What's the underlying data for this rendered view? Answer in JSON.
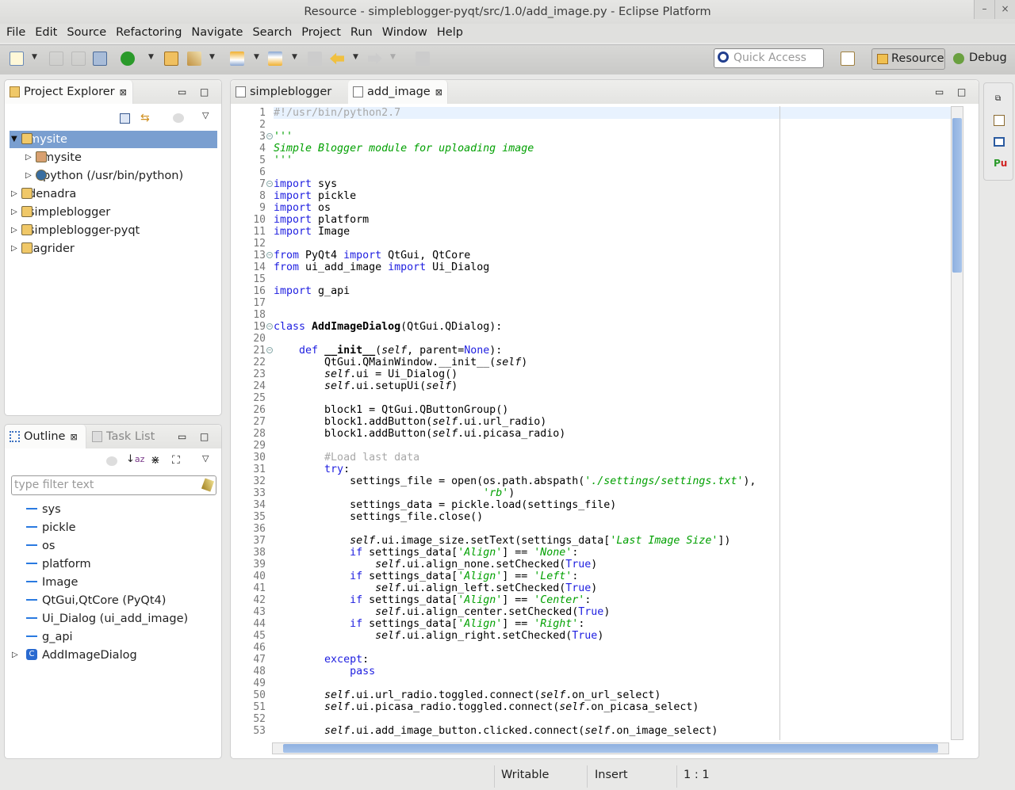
{
  "window": {
    "title": "Resource - simpleblogger-pyqt/src/1.0/add_image.py - Eclipse Platform",
    "controls": [
      "–",
      "×"
    ]
  },
  "menu": [
    "File",
    "Edit",
    "Source",
    "Refactoring",
    "Navigate",
    "Search",
    "Project",
    "Run",
    "Window",
    "Help"
  ],
  "toolbar": {
    "quick_access_placeholder": "Quick Access",
    "perspectives": [
      {
        "label": "Resource",
        "active": true
      },
      {
        "label": "Debug",
        "active": false
      }
    ]
  },
  "project_explorer": {
    "title": "Project Explorer",
    "close": "⊠",
    "items": [
      {
        "label": "mysite",
        "level": 0,
        "expanded": true,
        "selected": true,
        "icon": "pydev-project-icon"
      },
      {
        "label": "mysite",
        "level": 1,
        "icon": "package-icon"
      },
      {
        "label": "python (/usr/bin/python)",
        "level": 1,
        "icon": "python-interpreter-icon"
      },
      {
        "label": "denadra",
        "level": 0,
        "icon": "pydev-project-icon"
      },
      {
        "label": "simpleblogger",
        "level": 0,
        "icon": "pydev-project-icon"
      },
      {
        "label": "simpleblogger-pyqt",
        "level": 0,
        "icon": "pydev-project-icon"
      },
      {
        "label": "tagrider",
        "level": 0,
        "icon": "pydev-project-icon"
      }
    ]
  },
  "outline": {
    "title": "Outline",
    "close": "⊠",
    "other_tab": "Task List",
    "filter_placeholder": "type filter text",
    "items": [
      {
        "label": "sys",
        "type": "import"
      },
      {
        "label": "pickle",
        "type": "import"
      },
      {
        "label": "os",
        "type": "import"
      },
      {
        "label": "platform",
        "type": "import"
      },
      {
        "label": "Image",
        "type": "import"
      },
      {
        "label": "QtGui,QtCore (PyQt4)",
        "type": "import"
      },
      {
        "label": "Ui_Dialog (ui_add_image)",
        "type": "import"
      },
      {
        "label": "g_api",
        "type": "import"
      },
      {
        "label": "AddImageDialog",
        "type": "class"
      }
    ]
  },
  "editor": {
    "tabs": [
      {
        "label": "simpleblogger",
        "active": false
      },
      {
        "label": "add_image",
        "active": true,
        "close": "⊠"
      }
    ],
    "lines": [
      [
        [
          "c",
          "#!/usr/bin/python2.7"
        ]
      ],
      [],
      [
        [
          "s",
          "'''"
        ]
      ],
      [
        [
          "s",
          "Simple Blogger module for uploading image"
        ]
      ],
      [
        [
          "s",
          "'''"
        ]
      ],
      [],
      [
        [
          "k",
          "import"
        ],
        [
          "d",
          " sys"
        ]
      ],
      [
        [
          "k",
          "import"
        ],
        [
          "d",
          " pickle"
        ]
      ],
      [
        [
          "k",
          "import"
        ],
        [
          "d",
          " os"
        ]
      ],
      [
        [
          "k",
          "import"
        ],
        [
          "d",
          " platform"
        ]
      ],
      [
        [
          "k",
          "import"
        ],
        [
          "d",
          " Image"
        ]
      ],
      [],
      [
        [
          "k",
          "from"
        ],
        [
          "d",
          " PyQt4 "
        ],
        [
          "k",
          "import"
        ],
        [
          "d",
          " QtGui, QtCore"
        ]
      ],
      [
        [
          "k",
          "from"
        ],
        [
          "d",
          " ui_add_image "
        ],
        [
          "k",
          "import"
        ],
        [
          "d",
          " Ui_Dialog"
        ]
      ],
      [],
      [
        [
          "k",
          "import"
        ],
        [
          "d",
          " g_api"
        ]
      ],
      [],
      [],
      [
        [
          "k",
          "class"
        ],
        [
          "d",
          " "
        ],
        [
          "b",
          "AddImageDialog"
        ],
        [
          "d",
          "(QtGui.QDialog):"
        ]
      ],
      [],
      [
        [
          "d",
          "    "
        ],
        [
          "k",
          "def"
        ],
        [
          "d",
          " "
        ],
        [
          "b",
          "__init__"
        ],
        [
          "d",
          "("
        ],
        [
          "i",
          "self"
        ],
        [
          "d",
          ", parent="
        ],
        [
          "k",
          "None"
        ],
        [
          "d",
          "):"
        ]
      ],
      [
        [
          "d",
          "        QtGui.QMainWindow.__init__("
        ],
        [
          "i",
          "self"
        ],
        [
          "d",
          ")"
        ]
      ],
      [
        [
          "d",
          "        "
        ],
        [
          "i",
          "self"
        ],
        [
          "d",
          ".ui = Ui_Dialog()"
        ]
      ],
      [
        [
          "d",
          "        "
        ],
        [
          "i",
          "self"
        ],
        [
          "d",
          ".ui.setupUi("
        ],
        [
          "i",
          "self"
        ],
        [
          "d",
          ")"
        ]
      ],
      [],
      [
        [
          "d",
          "        block1 = QtGui.QButtonGroup()"
        ]
      ],
      [
        [
          "d",
          "        block1.addButton("
        ],
        [
          "i",
          "self"
        ],
        [
          "d",
          ".ui.url_radio)"
        ]
      ],
      [
        [
          "d",
          "        block1.addButton("
        ],
        [
          "i",
          "self"
        ],
        [
          "d",
          ".ui.picasa_radio)"
        ]
      ],
      [],
      [
        [
          "d",
          "        "
        ],
        [
          "c",
          "#Load last data"
        ]
      ],
      [
        [
          "d",
          "        "
        ],
        [
          "k",
          "try"
        ],
        [
          "d",
          ":"
        ]
      ],
      [
        [
          "d",
          "            settings_file = open(os.path.abspath("
        ],
        [
          "s",
          "'./settings/settings.txt'"
        ],
        [
          "d",
          "),"
        ]
      ],
      [
        [
          "d",
          "                                 "
        ],
        [
          "s",
          "'rb'"
        ],
        [
          "d",
          ")"
        ]
      ],
      [
        [
          "d",
          "            settings_data = pickle.load(settings_file)"
        ]
      ],
      [
        [
          "d",
          "            settings_file.close()"
        ]
      ],
      [],
      [
        [
          "d",
          "            "
        ],
        [
          "i",
          "self"
        ],
        [
          "d",
          ".ui.image_size.setText(settings_data["
        ],
        [
          "s",
          "'Last Image Size'"
        ],
        [
          "d",
          "])"
        ]
      ],
      [
        [
          "d",
          "            "
        ],
        [
          "k",
          "if"
        ],
        [
          "d",
          " settings_data["
        ],
        [
          "s",
          "'Align'"
        ],
        [
          "d",
          "] == "
        ],
        [
          "s",
          "'None'"
        ],
        [
          "d",
          ":"
        ]
      ],
      [
        [
          "d",
          "                "
        ],
        [
          "i",
          "self"
        ],
        [
          "d",
          ".ui.align_none.setChecked("
        ],
        [
          "k",
          "True"
        ],
        [
          "d",
          ")"
        ]
      ],
      [
        [
          "d",
          "            "
        ],
        [
          "k",
          "if"
        ],
        [
          "d",
          " settings_data["
        ],
        [
          "s",
          "'Align'"
        ],
        [
          "d",
          "] == "
        ],
        [
          "s",
          "'Left'"
        ],
        [
          "d",
          ":"
        ]
      ],
      [
        [
          "d",
          "                "
        ],
        [
          "i",
          "self"
        ],
        [
          "d",
          ".ui.align_left.setChecked("
        ],
        [
          "k",
          "True"
        ],
        [
          "d",
          ")"
        ]
      ],
      [
        [
          "d",
          "            "
        ],
        [
          "k",
          "if"
        ],
        [
          "d",
          " settings_data["
        ],
        [
          "s",
          "'Align'"
        ],
        [
          "d",
          "] == "
        ],
        [
          "s",
          "'Center'"
        ],
        [
          "d",
          ":"
        ]
      ],
      [
        [
          "d",
          "                "
        ],
        [
          "i",
          "self"
        ],
        [
          "d",
          ".ui.align_center.setChecked("
        ],
        [
          "k",
          "True"
        ],
        [
          "d",
          ")"
        ]
      ],
      [
        [
          "d",
          "            "
        ],
        [
          "k",
          "if"
        ],
        [
          "d",
          " settings_data["
        ],
        [
          "s",
          "'Align'"
        ],
        [
          "d",
          "] == "
        ],
        [
          "s",
          "'Right'"
        ],
        [
          "d",
          ":"
        ]
      ],
      [
        [
          "d",
          "                "
        ],
        [
          "i",
          "self"
        ],
        [
          "d",
          ".ui.align_right.setChecked("
        ],
        [
          "k",
          "True"
        ],
        [
          "d",
          ")"
        ]
      ],
      [],
      [
        [
          "d",
          "        "
        ],
        [
          "k",
          "except"
        ],
        [
          "d",
          ":"
        ]
      ],
      [
        [
          "d",
          "            "
        ],
        [
          "k",
          "pass"
        ]
      ],
      [],
      [
        [
          "d",
          "        "
        ],
        [
          "i",
          "self"
        ],
        [
          "d",
          ".ui.url_radio.toggled.connect("
        ],
        [
          "i",
          "self"
        ],
        [
          "d",
          ".on_url_select)"
        ]
      ],
      [
        [
          "d",
          "        "
        ],
        [
          "i",
          "self"
        ],
        [
          "d",
          ".ui.picasa_radio.toggled.connect("
        ],
        [
          "i",
          "self"
        ],
        [
          "d",
          ".on_picasa_select)"
        ]
      ],
      [],
      [
        [
          "d",
          "        "
        ],
        [
          "i",
          "self"
        ],
        [
          "d",
          ".ui.add_image_button.clicked.connect("
        ],
        [
          "i",
          "self"
        ],
        [
          "d",
          ".on_image_select)"
        ]
      ]
    ],
    "fold_lines": [
      3,
      7,
      13,
      19,
      21
    ]
  },
  "status": {
    "writable": "Writable",
    "insert_mode": "Insert",
    "position": "1 : 1"
  },
  "colors": {
    "keyword": "#1e1ee0",
    "string": "#00a000",
    "comment": "#a8a8a8",
    "selection": "#7a9fd0",
    "current_line": "#e8f2fe"
  }
}
